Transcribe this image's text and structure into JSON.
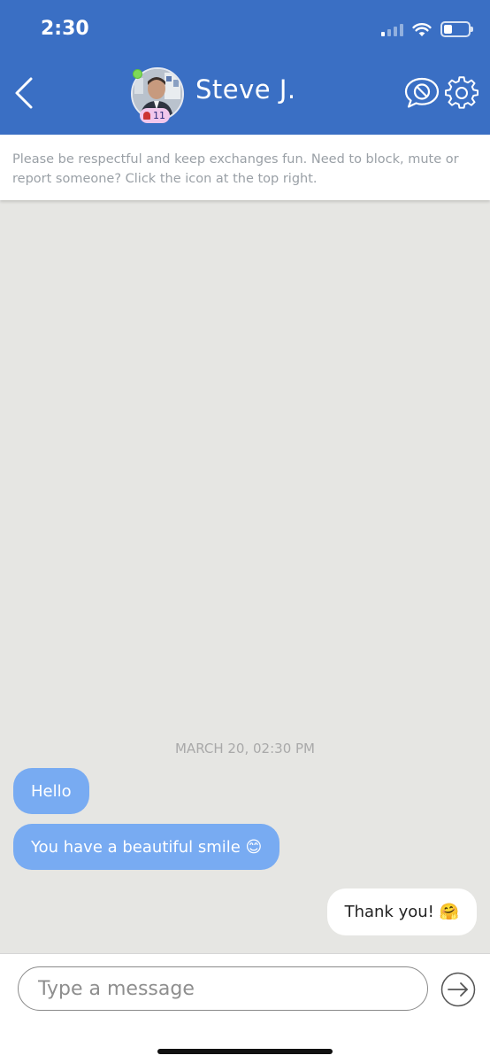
{
  "status_bar": {
    "time": "2:30",
    "battery_level": 0.35,
    "signal_bars_active": 1
  },
  "header": {
    "contact_name": "Steve J.",
    "level_badge": "11",
    "online": true,
    "bg_color": "#3a6fc4"
  },
  "icons": {
    "back": "chevron-left-icon",
    "block": "block-chat-icon",
    "settings": "gear-icon",
    "send": "arrow-right-circle-icon"
  },
  "notice": {
    "text": "Please be respectful and keep exchanges fun. Need to block, mute or report someone? Click the icon at the top right."
  },
  "chat": {
    "timestamp": "MARCH 20, 02:30 PM",
    "messages": [
      {
        "direction": "incoming",
        "text": "Hello"
      },
      {
        "direction": "incoming",
        "text": "You have a beautiful smile 😊"
      },
      {
        "direction": "outgoing",
        "text": "Thank you! 🤗"
      }
    ],
    "incoming_color": "#78abf2",
    "outgoing_color": "#ffffff",
    "bg_color": "#e6e6e3"
  },
  "composer": {
    "placeholder": "Type a message",
    "value": ""
  }
}
